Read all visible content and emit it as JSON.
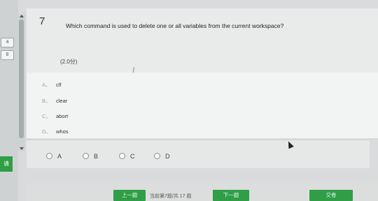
{
  "left_nav": {
    "question_numbers": [
      "4",
      "8"
    ],
    "submit_label": "请"
  },
  "question": {
    "number": "7",
    "text": "Which command is used to delete one or all variables from the current workspace?",
    "score": "(2.0分)",
    "options": [
      {
        "letter": "A、",
        "text": "clf"
      },
      {
        "letter": "B、",
        "text": "clear"
      },
      {
        "letter": "C、",
        "text": "abort"
      },
      {
        "letter": "D、",
        "text": "whos"
      }
    ]
  },
  "answer_choices": [
    "A",
    "B",
    "C",
    "D"
  ],
  "footer": {
    "prev_label": "上一题",
    "page_info": "当前第7题/共 17 题",
    "next_label": "下一题",
    "submit_label": "交卷"
  },
  "colors": {
    "accent_green": "#2f9e46",
    "panel_bg": "#e9ebea"
  }
}
